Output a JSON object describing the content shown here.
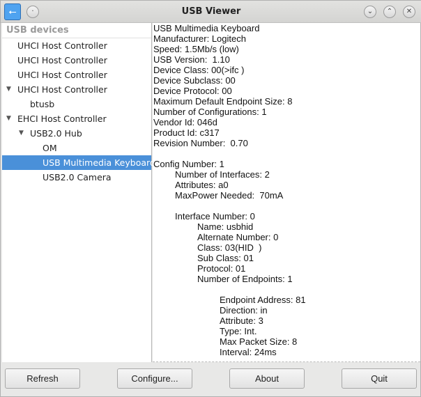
{
  "window": {
    "title": "USB Viewer",
    "app_icon": "usb-icon"
  },
  "tree": {
    "header": "USB devices",
    "items": [
      {
        "label": "UHCI Host Controller",
        "level": 0,
        "expanded": null
      },
      {
        "label": "UHCI Host Controller",
        "level": 0,
        "expanded": null
      },
      {
        "label": "UHCI Host Controller",
        "level": 0,
        "expanded": null
      },
      {
        "label": "UHCI Host Controller",
        "level": 0,
        "expanded": true
      },
      {
        "label": "btusb",
        "level": 1,
        "expanded": null
      },
      {
        "label": "EHCI Host Controller",
        "level": 0,
        "expanded": true
      },
      {
        "label": "USB2.0 Hub",
        "level": 1,
        "expanded": true
      },
      {
        "label": "OM",
        "level": 2,
        "expanded": null
      },
      {
        "label": "USB Multimedia Keyboard",
        "level": 2,
        "expanded": null,
        "selected": true
      },
      {
        "label": "USB2.0 Camera",
        "level": 2,
        "expanded": null
      }
    ]
  },
  "detail": {
    "lines": [
      {
        "t": "USB Multimedia Keyboard",
        "i": 0
      },
      {
        "t": "Manufacturer: Logitech",
        "i": 0
      },
      {
        "t": "Speed: 1.5Mb/s (low)",
        "i": 0
      },
      {
        "t": "USB Version:  1.10",
        "i": 0
      },
      {
        "t": "Device Class: 00(>ifc )",
        "i": 0
      },
      {
        "t": "Device Subclass: 00",
        "i": 0
      },
      {
        "t": "Device Protocol: 00",
        "i": 0
      },
      {
        "t": "Maximum Default Endpoint Size: 8",
        "i": 0
      },
      {
        "t": "Number of Configurations: 1",
        "i": 0
      },
      {
        "t": "Vendor Id: 046d",
        "i": 0
      },
      {
        "t": "Product Id: c317",
        "i": 0
      },
      {
        "t": "Revision Number:  0.70",
        "i": 0
      },
      {
        "t": "",
        "i": 0
      },
      {
        "t": "Config Number: 1",
        "i": 0
      },
      {
        "t": "Number of Interfaces: 2",
        "i": 1
      },
      {
        "t": "Attributes: a0",
        "i": 1
      },
      {
        "t": "MaxPower Needed:  70mA",
        "i": 1
      },
      {
        "t": "",
        "i": 0
      },
      {
        "t": "Interface Number: 0",
        "i": 1
      },
      {
        "t": "Name: usbhid",
        "i": 2
      },
      {
        "t": "Alternate Number: 0",
        "i": 2
      },
      {
        "t": "Class: 03(HID  )",
        "i": 2
      },
      {
        "t": "Sub Class: 01",
        "i": 2
      },
      {
        "t": "Protocol: 01",
        "i": 2
      },
      {
        "t": "Number of Endpoints: 1",
        "i": 2
      },
      {
        "t": "",
        "i": 0
      },
      {
        "t": "Endpoint Address: 81",
        "i": 3
      },
      {
        "t": "Direction: in",
        "i": 3
      },
      {
        "t": "Attribute: 3",
        "i": 3
      },
      {
        "t": "Type: Int.",
        "i": 3
      },
      {
        "t": "Max Packet Size: 8",
        "i": 3
      },
      {
        "t": "Interval: 24ms",
        "i": 3
      }
    ]
  },
  "buttons": {
    "refresh": "Refresh",
    "configure": "Configure...",
    "about": "About",
    "quit": "Quit"
  }
}
